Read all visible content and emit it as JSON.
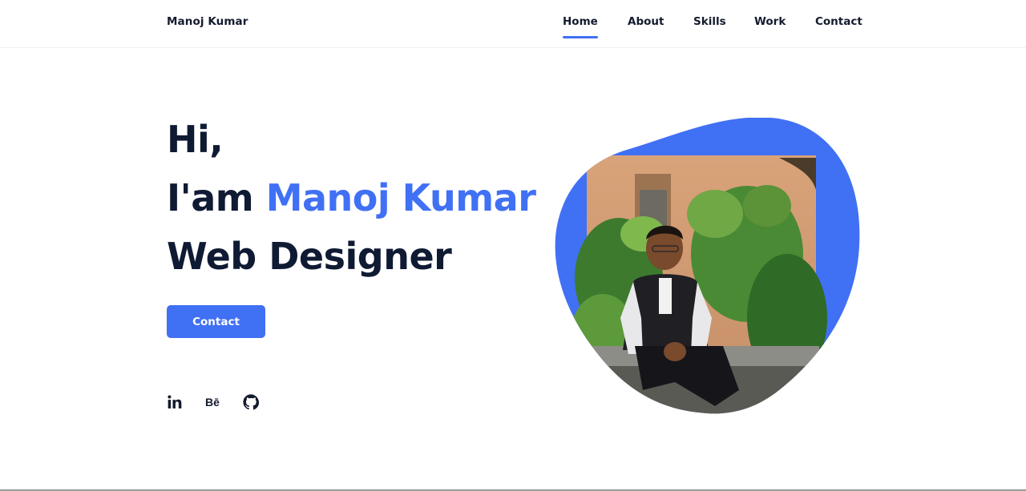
{
  "header": {
    "logo": "Manoj Kumar",
    "nav": [
      {
        "label": "Home",
        "active": true
      },
      {
        "label": "About",
        "active": false
      },
      {
        "label": "Skills",
        "active": false
      },
      {
        "label": "Work",
        "active": false
      },
      {
        "label": "Contact",
        "active": false
      }
    ]
  },
  "hero": {
    "greeting": "Hi,",
    "intro_prefix": "I'am ",
    "name": "Manoj Kumar",
    "role": "Web Designer",
    "cta_label": "Contact"
  },
  "social": [
    {
      "icon": "linkedin-icon",
      "text": "in"
    },
    {
      "icon": "behance-icon",
      "text": "Bē"
    },
    {
      "icon": "github-icon",
      "text": ""
    }
  ],
  "colors": {
    "accent": "#4070f4",
    "text": "#0f1a33",
    "background": "#ffffff"
  }
}
